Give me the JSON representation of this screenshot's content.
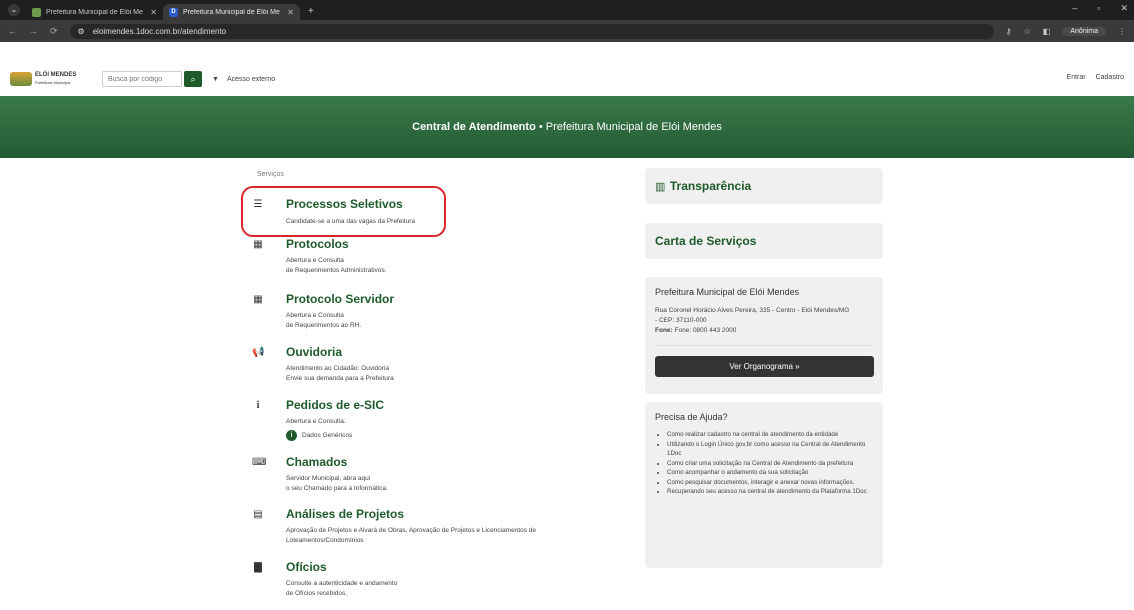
{
  "browser": {
    "tabs": [
      {
        "title": "Prefeitura Municipal de Elói Me",
        "active": false
      },
      {
        "title": "Prefeitura Municipal de Elói Me",
        "active": true
      }
    ],
    "url": "eloimendes.1doc.com.br/atendimento",
    "profile": "Anônima"
  },
  "header": {
    "logo_name": "ELÓI MENDES",
    "logo_sub": "Prefeitura Municipal",
    "search_placeholder": "Busca por código",
    "external_access": "Acesso externo",
    "login": "Entrar",
    "register": "Cadastro"
  },
  "banner": {
    "title": "Central de Atendimento",
    "separator": " • ",
    "subtitle": "Prefeitura Municipal de Elói Mendes"
  },
  "services": {
    "label": "Serviços",
    "items": [
      {
        "icon": "list-icon",
        "title": "Processos Seletivos",
        "desc": "Candidate-se a uma das vagas da Prefeitura"
      },
      {
        "icon": "qr-icon",
        "title": "Protocolos",
        "desc": "Abertura e Consulta\nde Requerimentos Administrativos."
      },
      {
        "icon": "qr-icon",
        "title": "Protocolo Servidor",
        "desc": "Abertura e Consulta\nde Requerimentos ao RH."
      },
      {
        "icon": "megaphone-icon",
        "title": "Ouvidoria",
        "desc": "Atendimento ao Cidadão: Ouvidoria\nEnvie sua demanda para a Prefeitura"
      },
      {
        "icon": "info-icon",
        "title": "Pedidos de e-SIC",
        "desc": "Abertura e Consulta."
      },
      {
        "icon": "keyboard-icon",
        "title": "Chamados",
        "desc": "Servidor Municipal, abra aqui\no seu Chamado para a Informática."
      },
      {
        "icon": "documents-icon",
        "title": "Análises de Projetos",
        "desc": "Aprovação de Projetos e Alvará de Obras, Aprovação de Projetos e Licenciamentos de\nLoteamentos/Condomínios"
      },
      {
        "icon": "file-icon",
        "title": "Ofícios",
        "desc": "Consulte a autenticidade e andamento\nde Ofícios recebidos."
      }
    ],
    "esic_sub": "Dados Genéricos"
  },
  "sidebar": {
    "transparencia": "Transparência",
    "carta": "Carta de Serviços",
    "pref_title": "Prefeitura Municipal de Elói Mendes",
    "address": "Rua Coronel Horácio Alves Pereira, 335 - Centro - Elói Mendes/MG\n- CEP: 37110-000",
    "phone_label": "Fone:",
    "phone": "Fone: 0800 443 2000",
    "org_button": "Ver Organograma »",
    "help_title": "Precisa de Ajuda?",
    "help_items": [
      "Como realizar cadastro na central de atendimento da entidade",
      "Utilizando o Login Único gov.br como acesso na Central de Atendimento 1Doc",
      "Como criar uma solicitação na Central de Atendimento da prefeitura",
      "Como acompanhar o andamento da sua solicitação",
      "Como pesquisar documentos, interagir e anexar novas informações.",
      "Recuperando seu acesso na central de atendimento da Plataforma 1Doc"
    ]
  },
  "colors": {
    "brand_green": "#1e5a2a",
    "banner_green": "#2e6b3f",
    "highlight_red": "#d8262b"
  }
}
